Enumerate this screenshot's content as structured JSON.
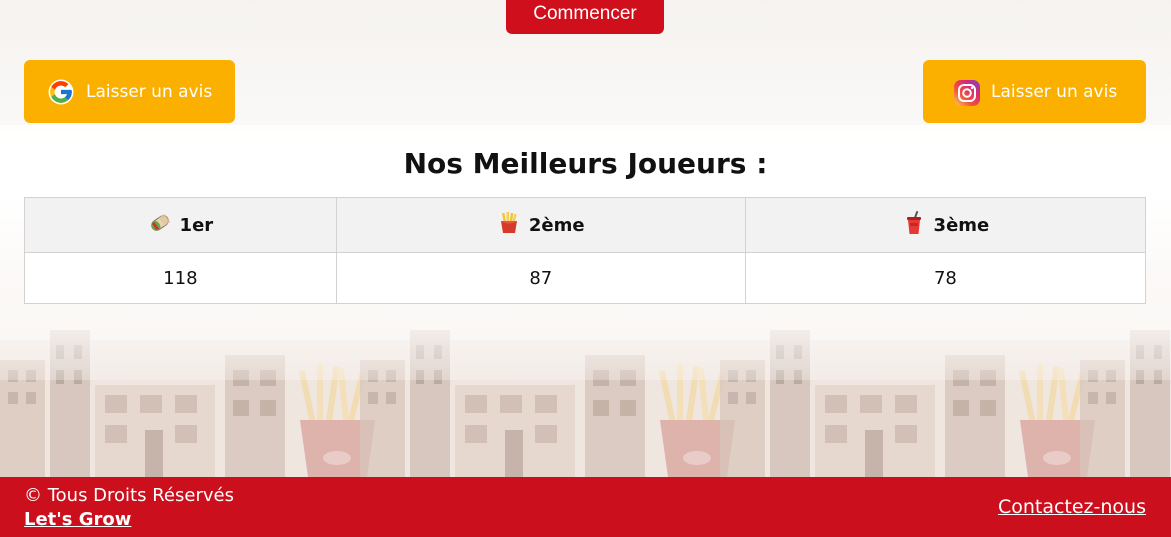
{
  "start_button": {
    "label": "Commencer"
  },
  "reviews": [
    {
      "platform_icon": "google-icon",
      "label": "Laisser un avis"
    },
    {
      "platform_icon": "instagram-icon",
      "label": "Laisser un avis"
    }
  ],
  "leaderboard": {
    "title": "Nos Meilleurs Joueurs :",
    "columns": [
      {
        "icon": "wrap-emoji-icon",
        "label": "1er"
      },
      {
        "icon": "fries-emoji-icon",
        "label": "2ème"
      },
      {
        "icon": "drink-cup-emoji-icon",
        "label": "3ème"
      }
    ],
    "scores": [
      "118",
      "87",
      "78"
    ]
  },
  "footer": {
    "rights": "© Tous Droits Réservés",
    "brand": "Let's Grow",
    "contact": "Contactez-nous"
  },
  "colors": {
    "brand_red": "#cc0f1d",
    "button_yellow": "#fbb000",
    "table_header_bg": "#f2f2f2"
  }
}
